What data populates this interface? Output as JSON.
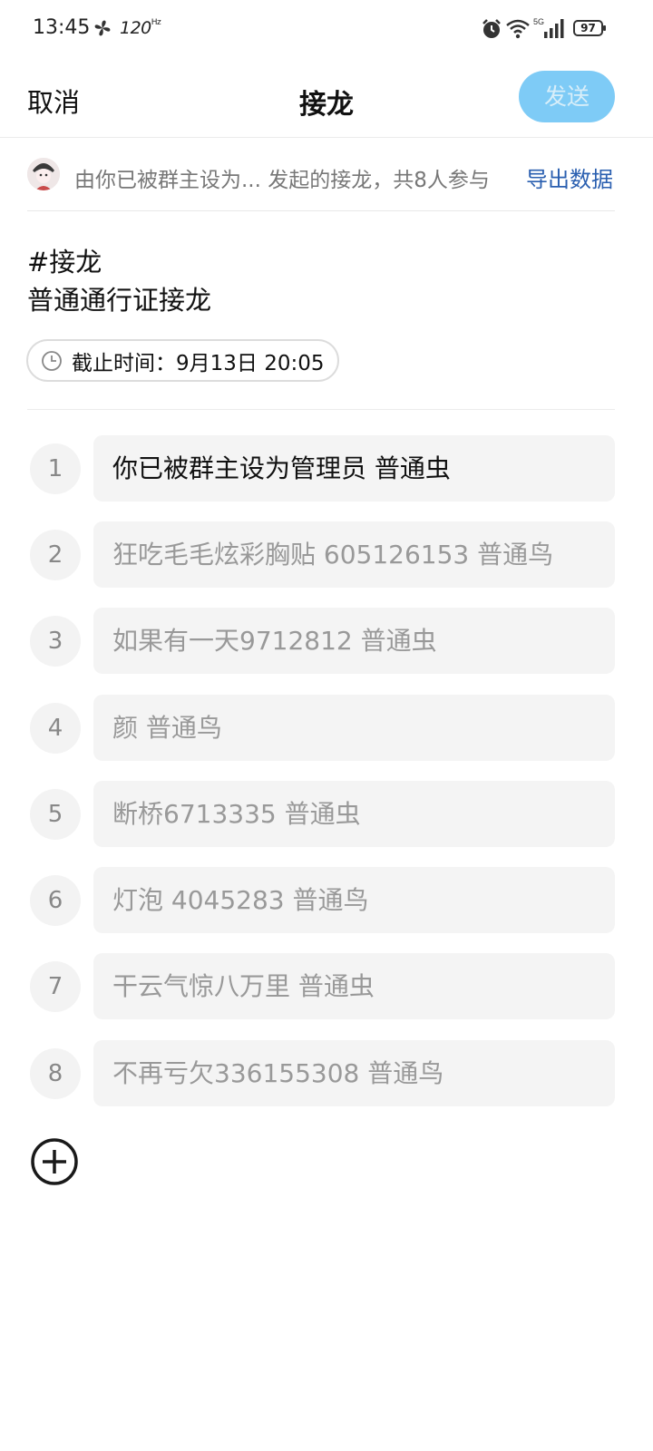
{
  "status_bar": {
    "time": "13:45",
    "refresh_rate": "120",
    "refresh_unit": "Hz",
    "battery": "97"
  },
  "header": {
    "cancel_label": "取消",
    "title": "接龙",
    "send_label": "发送"
  },
  "initiator": {
    "text": "由你已被群主设为... 发起的接龙，共8人参与",
    "export_label": "导出数据"
  },
  "topic": {
    "line1": "#接龙",
    "line2": "普通通行证接龙",
    "deadline": "截止时间：9月13日 20:05"
  },
  "entries": [
    {
      "num": "1",
      "text": "你已被群主设为管理员 普通虫"
    },
    {
      "num": "2",
      "text": "狂吃毛毛炫彩胸贴 605126153 普通鸟"
    },
    {
      "num": "3",
      "text": "如果有一天9712812  普通虫"
    },
    {
      "num": "4",
      "text": "颜 普通鸟"
    },
    {
      "num": "5",
      "text": "断桥6713335 普通虫"
    },
    {
      "num": "6",
      "text": "灯泡 4045283 普通鸟"
    },
    {
      "num": "7",
      "text": "干云气惊八万里 普通虫"
    },
    {
      "num": "8",
      "text": "不再亏欠336155308  普通鸟"
    }
  ],
  "colors": {
    "accent_link": "#2a5fb0",
    "send_button_disabled": "#7ecbf6"
  }
}
